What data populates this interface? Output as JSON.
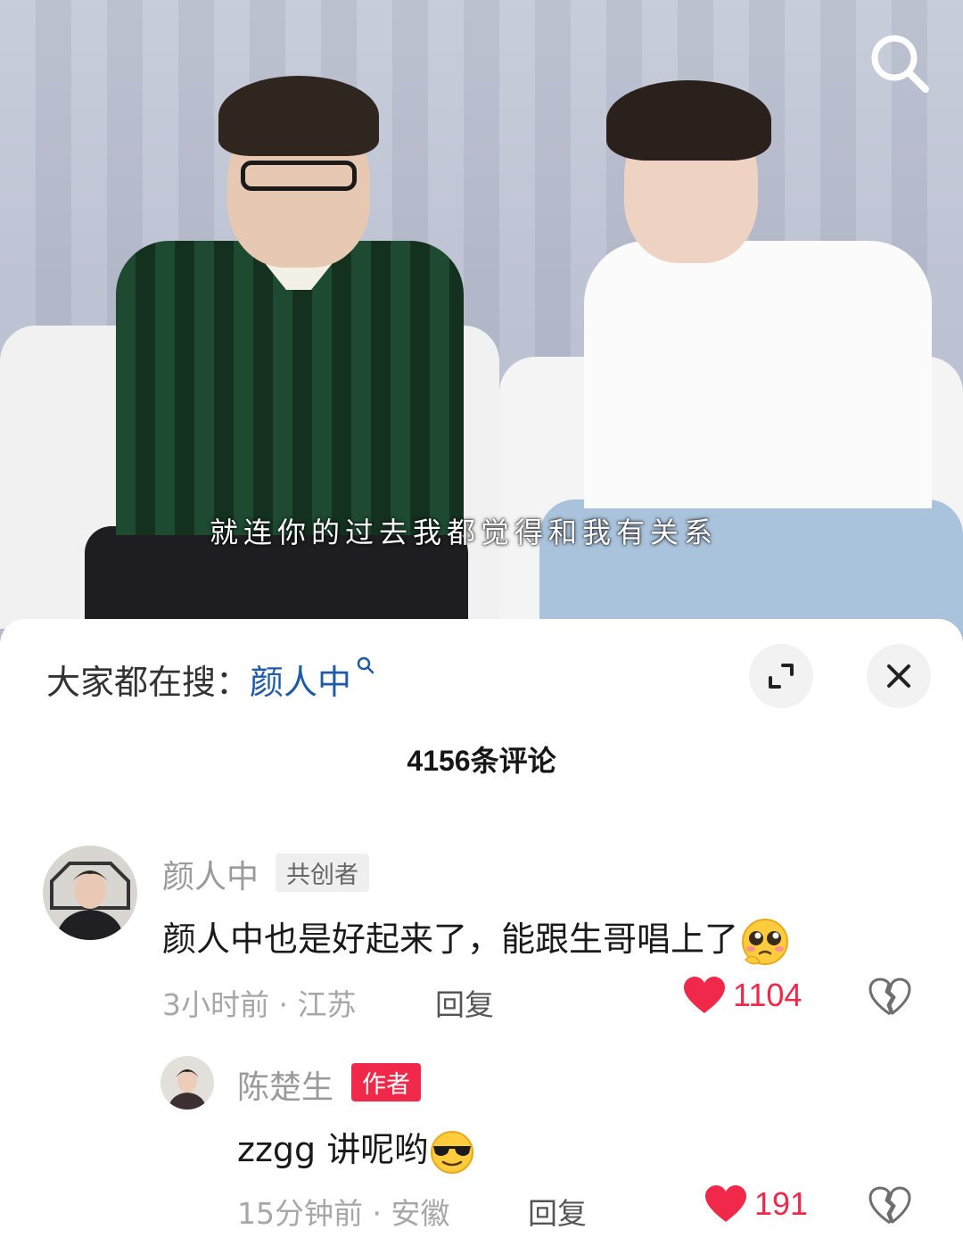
{
  "video": {
    "subtitle": "就连你的过去我都觉得和我有关系",
    "search_icon": "search-icon"
  },
  "search_hint": {
    "prefix": "大家都在搜：",
    "term": "颜人中",
    "icon": "search-icon"
  },
  "controls": {
    "expand_icon": "expand-icon",
    "close_icon": "close-icon"
  },
  "comments_header": {
    "title": "4156条评论"
  },
  "comments": [
    {
      "username": "颜人中",
      "tag": "共创者",
      "text": "颜人中也是好起来了，能跟生哥唱上了",
      "emoji": "pleading-face-emoji",
      "time": "3小时前",
      "separator": "·",
      "location": "江苏",
      "reply_label": "回复",
      "likes": "1104",
      "like_icon": "heart-icon",
      "dislike_icon": "broken-heart-icon"
    },
    {
      "username": "陈楚生",
      "tag": "作者",
      "text": "zzgg 讲呢哟",
      "emoji": "sunglasses-emoji",
      "time": "15分钟前",
      "separator": "·",
      "location": "安徽",
      "reply_label": "回复",
      "likes": "191",
      "like_icon": "heart-icon",
      "dislike_icon": "broken-heart-icon"
    }
  ],
  "colors": {
    "accent_red": "#f0294a",
    "link_blue": "#1f5aa8",
    "meta_gray": "#a7a7a7"
  }
}
